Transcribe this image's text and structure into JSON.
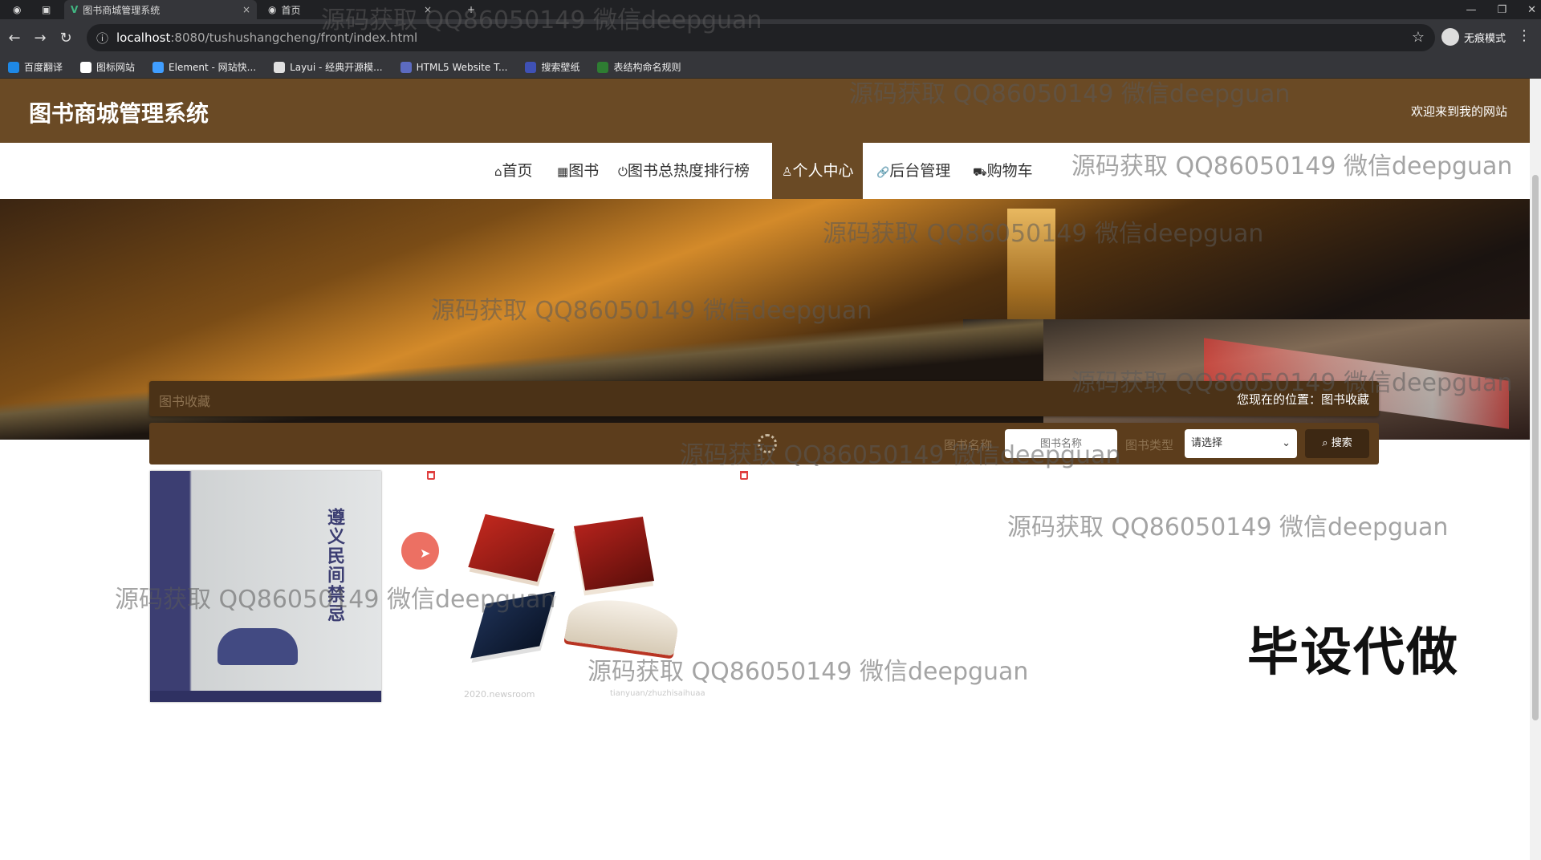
{
  "browser": {
    "tabs": [
      {
        "label": "图书商城管理系统"
      },
      {
        "label": "首页"
      }
    ],
    "url_host": "localhost",
    "url_path": ":8080/tushushangcheng/front/index.html",
    "profile_label": "无痕模式",
    "bookmarks": [
      {
        "label": "百度翻译",
        "color": "#1e88e5"
      },
      {
        "label": "图标网站",
        "color": "#ffffff"
      },
      {
        "label": "Element - 网站快...",
        "color": "#409eff"
      },
      {
        "label": "Layui - 经典开源模...",
        "color": "#e0e0e0"
      },
      {
        "label": "HTML5 Website T...",
        "color": "#5c6bc0"
      },
      {
        "label": "搜索壁纸",
        "color": "#3f51b5"
      },
      {
        "label": "表结构命名规则",
        "color": "#2e7d32"
      }
    ]
  },
  "site": {
    "title": "图书商城管理系统",
    "welcome": "欢迎来到我的网站",
    "accent_color": "#6a4a25"
  },
  "nav": {
    "items": [
      {
        "label": "首页",
        "icon": "home-icon"
      },
      {
        "label": "图书",
        "icon": "grid-icon"
      },
      {
        "label": "图书总热度排行榜",
        "icon": "power-icon"
      },
      {
        "label": "个人中心",
        "icon": "user-icon",
        "active": true
      },
      {
        "label": "后台管理",
        "icon": "link-icon"
      },
      {
        "label": "购物车",
        "icon": "cart-icon"
      }
    ],
    "icons": {
      "home": "⌂",
      "grid": "▦",
      "power": "⏻",
      "user": "♙",
      "link": "🔗",
      "cart": "⛟"
    }
  },
  "section": {
    "title": "图书收藏",
    "breadcrumb": "您现在的位置：图书收藏"
  },
  "search": {
    "name_label": "图书名称",
    "name_placeholder": "图书名称",
    "type_label": "图书类型",
    "type_selected": "请选择",
    "button_label": "搜索"
  },
  "books": [
    {
      "cover_title": "遵义民间禁忌"
    },
    {
      "cover_title": ""
    }
  ],
  "captions": [
    "2020.newsroom",
    "tianyuan/zhuzhisaihuaa"
  ],
  "watermarks": [
    "源码获取 QQ86050149 微信deepguan",
    "源码获取 QQ86050149 微信deepguan",
    "源码获取 QQ86050149 微信deepguan",
    "源码获取 QQ86050149 微信deepguan",
    "源码获取 QQ86050149 微信deepguan",
    "源码获取 QQ86050149 微信deepguan",
    "源码获取 QQ86050149 微信deepguan",
    "源码获取 QQ86050149 微信deepguan",
    "源码获取 QQ86050149 微信deepguan",
    "源码获取 QQ86050149 微信deepguan"
  ],
  "promo_text": "毕设代做"
}
